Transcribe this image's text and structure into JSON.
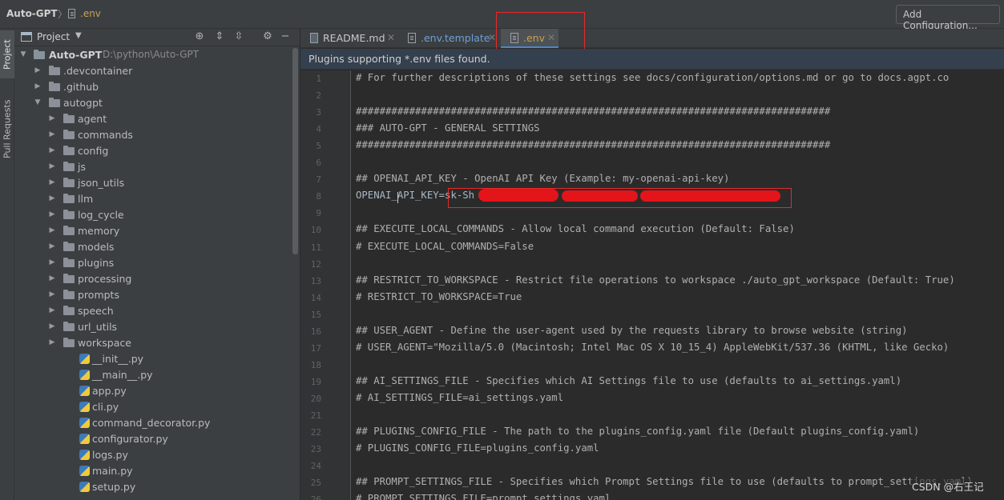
{
  "titlebar": {
    "project": "Auto-GPT",
    "separator": "〉",
    "file": ".env",
    "add_configuration": "Add Configuration..."
  },
  "toolstrip": {
    "project": "Project",
    "pull_requests": "Pull Requests"
  },
  "project_panel": {
    "title": "Project",
    "root": {
      "name": "Auto-GPT",
      "path": "D:\\python\\Auto-GPT"
    },
    "items": [
      {
        "name": ".devcontainer",
        "kind": "folder",
        "level": 1
      },
      {
        "name": ".github",
        "kind": "folder",
        "level": 1
      },
      {
        "name": "autogpt",
        "kind": "folder-open",
        "level": 1
      },
      {
        "name": "agent",
        "kind": "folder",
        "level": 2
      },
      {
        "name": "commands",
        "kind": "folder",
        "level": 2
      },
      {
        "name": "config",
        "kind": "folder",
        "level": 2
      },
      {
        "name": "js",
        "kind": "folder",
        "level": 2
      },
      {
        "name": "json_utils",
        "kind": "folder",
        "level": 2
      },
      {
        "name": "llm",
        "kind": "folder",
        "level": 2
      },
      {
        "name": "log_cycle",
        "kind": "folder",
        "level": 2
      },
      {
        "name": "memory",
        "kind": "folder",
        "level": 2
      },
      {
        "name": "models",
        "kind": "folder",
        "level": 2
      },
      {
        "name": "plugins",
        "kind": "folder",
        "level": 2
      },
      {
        "name": "processing",
        "kind": "folder",
        "level": 2
      },
      {
        "name": "prompts",
        "kind": "folder",
        "level": 2
      },
      {
        "name": "speech",
        "kind": "folder",
        "level": 2
      },
      {
        "name": "url_utils",
        "kind": "folder",
        "level": 2
      },
      {
        "name": "workspace",
        "kind": "folder",
        "level": 2
      },
      {
        "name": "__init__.py",
        "kind": "python",
        "level": 2
      },
      {
        "name": "__main__.py",
        "kind": "python",
        "level": 2
      },
      {
        "name": "app.py",
        "kind": "python",
        "level": 2
      },
      {
        "name": "cli.py",
        "kind": "python",
        "level": 2
      },
      {
        "name": "command_decorator.py",
        "kind": "python",
        "level": 2
      },
      {
        "name": "configurator.py",
        "kind": "python",
        "level": 2
      },
      {
        "name": "logs.py",
        "kind": "python",
        "level": 2
      },
      {
        "name": "main.py",
        "kind": "python",
        "level": 2
      },
      {
        "name": "setup.py",
        "kind": "python",
        "level": 2
      }
    ]
  },
  "tabs": [
    {
      "label": "README.md",
      "icon": "markdown-file-icon",
      "active": false
    },
    {
      "label": ".env.template",
      "icon": "text-file-icon",
      "active": false
    },
    {
      "label": ".env",
      "icon": "text-file-icon",
      "active": true
    }
  ],
  "banner": "Plugins supporting *.env files found.",
  "editor": {
    "lines": [
      "# For further descriptions of these settings see docs/configuration/options.md or go to docs.agpt.co",
      "",
      "################################################################################",
      "### AUTO-GPT - GENERAL SETTINGS",
      "################################################################################",
      "",
      "## OPENAI_API_KEY - OpenAI API Key (Example: my-openai-api-key)",
      "OPENAI_API_KEY=sk-Sh",
      "",
      "## EXECUTE_LOCAL_COMMANDS - Allow local command execution (Default: False)",
      "# EXECUTE_LOCAL_COMMANDS=False",
      "",
      "## RESTRICT_TO_WORKSPACE - Restrict file operations to workspace ./auto_gpt_workspace (Default: True)",
      "# RESTRICT_TO_WORKSPACE=True",
      "",
      "## USER_AGENT - Define the user-agent used by the requests library to browse website (string)",
      "# USER_AGENT=\"Mozilla/5.0 (Macintosh; Intel Mac OS X 10_15_4) AppleWebKit/537.36 (KHTML, like Gecko)",
      "",
      "## AI_SETTINGS_FILE - Specifies which AI Settings file to use (defaults to ai_settings.yaml)",
      "# AI_SETTINGS_FILE=ai_settings.yaml",
      "",
      "## PLUGINS_CONFIG_FILE - The path to the plugins_config.yaml file (Default plugins_config.yaml)",
      "# PLUGINS_CONFIG_FILE=plugins_config.yaml",
      "",
      "## PROMPT_SETTINGS_FILE - Specifies which Prompt Settings file to use (defaults to prompt_settings.yaml)",
      "# PROMPT_SETTINGS_FILE=prompt_settings.yaml"
    ],
    "line_numbers": [
      "1",
      "2",
      "3",
      "4",
      "5",
      "6",
      "7",
      "8",
      "9",
      "10",
      "11",
      "12",
      "13",
      "14",
      "15",
      "16",
      "17",
      "18",
      "19",
      "20",
      "21",
      "22",
      "23",
      "24",
      "25",
      "26"
    ]
  },
  "watermark": "CSDN @右王记",
  "colors": {
    "accent": "#4a88c7",
    "annotation_red": "#e52a2a",
    "env_file": "#c8a14e"
  }
}
